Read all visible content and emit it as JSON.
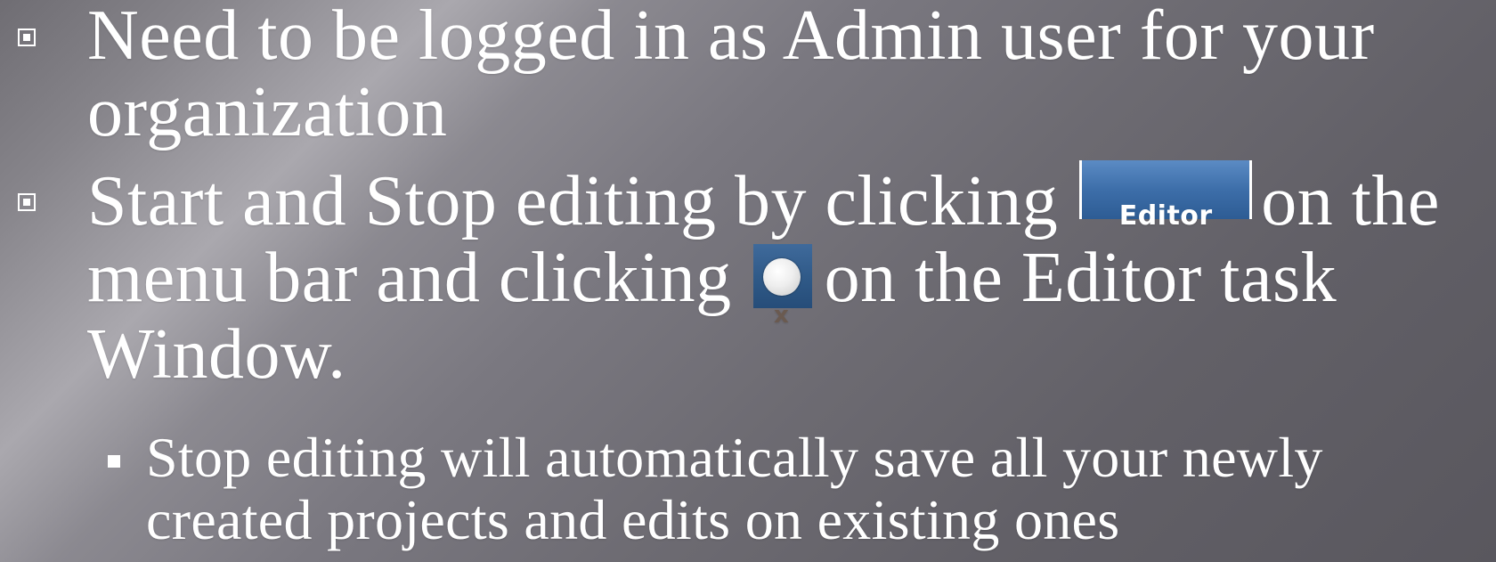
{
  "bullets": [
    {
      "lines": [
        "Need to be logged in as Admin user for your",
        "organization"
      ]
    },
    {
      "line1_before": "Start and Stop editing by clicking",
      "line1_after": "on the",
      "line2_before": "menu bar and clicking",
      "line2_after": "on the Editor task",
      "line3": "Window."
    }
  ],
  "sub_bullet": {
    "lines": [
      "Stop editing will automatically save all your newly",
      "created projects and edits on existing ones"
    ]
  },
  "editor_button": {
    "label": "Editor"
  },
  "close_button": {
    "glyph": "x",
    "icon": "close-icon"
  },
  "colors": {
    "text": "#ffffff",
    "editor_button_bg": "#3d6ea9",
    "close_button_bg": "#2f5987"
  }
}
